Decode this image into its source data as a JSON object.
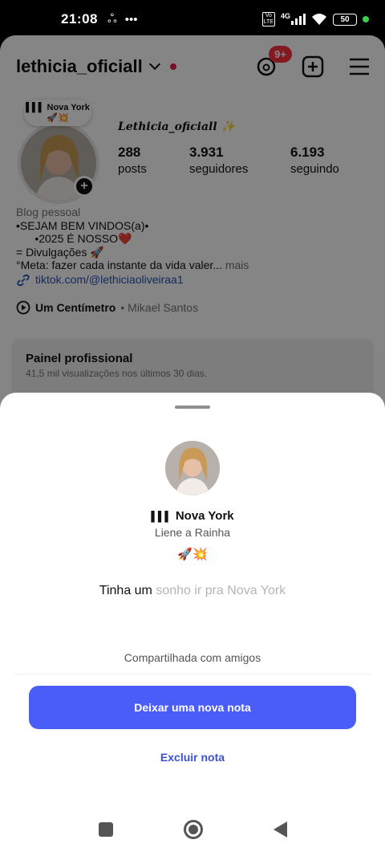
{
  "status_bar": {
    "time": "21:08",
    "battery": "50",
    "network": "4G"
  },
  "profile": {
    "username": "lethicia_oficiall",
    "notifications_badge": "9+",
    "note_bubble": {
      "title": "Nova York",
      "emoji": "🚀💥"
    },
    "display_name": "Lethicia_oficiall ✨",
    "stats": [
      {
        "value": "288",
        "label": "posts"
      },
      {
        "value": "3.931",
        "label": "seguidores"
      },
      {
        "value": "6.193",
        "label": "seguindo"
      }
    ],
    "category": "Blog pessoal",
    "bio_lines": [
      "•SEJAM BEM VINDOS(a)•",
      "      •2025 É NOSSO❤️",
      "= Divulgações 🚀"
    ],
    "bio_last": "°Meta: fazer cada instante da vida valer...",
    "bio_more": " mais",
    "link": "tiktok.com/@lethiciaoliveiraa1",
    "music": {
      "title": "Um Centímetro",
      "artist": " • Mikael Santos"
    },
    "pro_panel": {
      "title": "Painel profissional",
      "subtitle": "41,5 mil visualizações nos últimos 30 dias."
    }
  },
  "sheet": {
    "song_title": "Nova York",
    "song_artist": "Liene a Rainha",
    "emoji": "🚀💥",
    "lyrics_sung": "Tinha um",
    "lyrics_unsung": " sonho ir pra Nova York",
    "shared_with": "Compartilhada com amigos",
    "primary_button": "Deixar uma nova nota",
    "delete_button": "Excluir nota"
  }
}
